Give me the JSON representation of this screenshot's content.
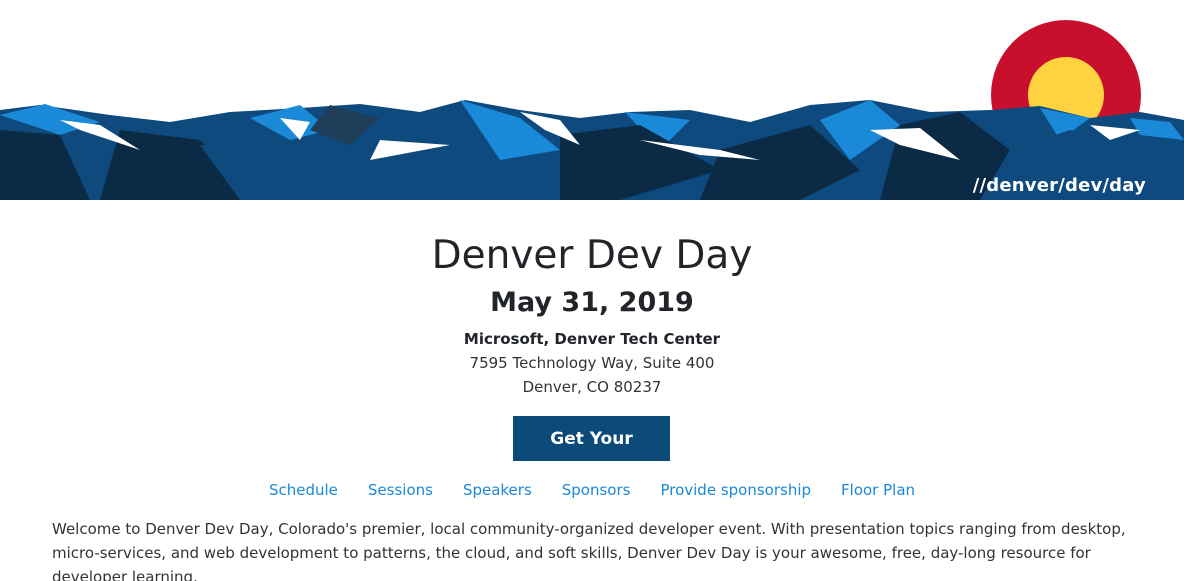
{
  "banner": {
    "tag": "//denver/dev/day",
    "colors": {
      "sky": "#ffffff",
      "flag_red": "#c8102e",
      "flag_gold": "#ffd23f",
      "mountain_dark": "#0b2a45",
      "mountain_mid": "#0e4a7e",
      "mountain_light": "#1a8ad8",
      "snow": "#ffffff"
    }
  },
  "event": {
    "title": "Denver Dev Day",
    "date": "May 31, 2019",
    "venue_name": "Microsoft, Denver Tech Center",
    "venue_street": "7595 Technology Way, Suite 400",
    "venue_city": "Denver, CO 80237"
  },
  "cta": {
    "tickets_label": "Get Your Tickets",
    "color": "#0c4a7a"
  },
  "nav": {
    "items": [
      {
        "label": "Schedule"
      },
      {
        "label": "Sessions"
      },
      {
        "label": "Speakers"
      },
      {
        "label": "Sponsors"
      },
      {
        "label": "Provide sponsorship"
      },
      {
        "label": "Floor Plan"
      }
    ],
    "link_color": "#1a88d6"
  },
  "intro": {
    "text": "Welcome to Denver Dev Day, Colorado's premier, local community-organized developer event. With presentation topics ranging from desktop, micro-services, and web development to patterns, the cloud, and soft skills, Denver Dev Day is your awesome, free, day-long resource for developer learning."
  }
}
